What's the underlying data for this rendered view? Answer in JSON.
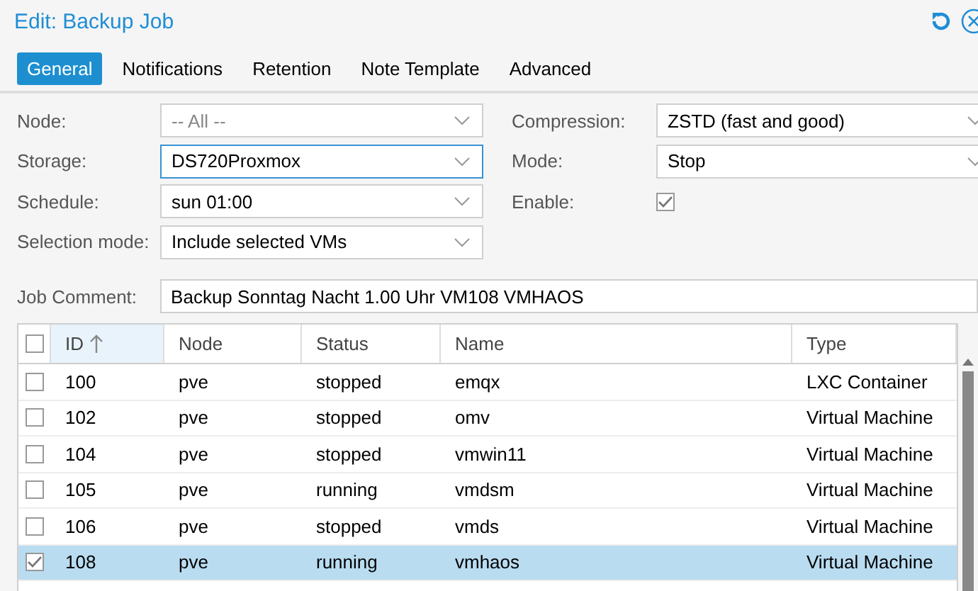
{
  "window": {
    "title": "Edit: Backup Job"
  },
  "tabs": [
    {
      "label": "General",
      "selected": true
    },
    {
      "label": "Notifications",
      "selected": false
    },
    {
      "label": "Retention",
      "selected": false
    },
    {
      "label": "Note Template",
      "selected": false
    },
    {
      "label": "Advanced",
      "selected": false
    }
  ],
  "left_fields": [
    {
      "label": "Node:",
      "kind": "select",
      "placeholder": "-- All --",
      "focused": false
    },
    {
      "label": "Storage:",
      "kind": "select",
      "value": "DS720Proxmox",
      "focused": true
    },
    {
      "label": "Schedule:",
      "kind": "select",
      "value": "sun 01:00",
      "focused": false
    },
    {
      "label": "Selection mode:",
      "kind": "select",
      "value": "Include selected VMs",
      "focused": false
    }
  ],
  "right_fields": [
    {
      "label": "Compression:",
      "kind": "select",
      "value": "ZSTD (fast and good)"
    },
    {
      "label": "Mode:",
      "kind": "select",
      "value": "Stop"
    },
    {
      "label": "Enable:",
      "kind": "checkbox",
      "checked": true
    }
  ],
  "job_comment": {
    "label": "Job Comment:",
    "value": "Backup Sonntag Nacht 1.00 Uhr VM108 VMHAOS"
  },
  "table": {
    "all_checked": false,
    "columns": [
      {
        "label": "ID",
        "sorted": true
      },
      {
        "label": "Node",
        "sorted": false
      },
      {
        "label": "Status",
        "sorted": false
      },
      {
        "label": "Name",
        "sorted": false
      },
      {
        "label": "Type",
        "sorted": false
      }
    ],
    "rows": [
      {
        "checked": false,
        "selected": false,
        "cells": [
          "100",
          "pve",
          "stopped",
          "emqx",
          "LXC Container"
        ]
      },
      {
        "checked": false,
        "selected": false,
        "cells": [
          "102",
          "pve",
          "stopped",
          "omv",
          "Virtual Machine"
        ]
      },
      {
        "checked": false,
        "selected": false,
        "cells": [
          "104",
          "pve",
          "stopped",
          "vmwin11",
          "Virtual Machine"
        ]
      },
      {
        "checked": false,
        "selected": false,
        "cells": [
          "105",
          "pve",
          "running",
          "vmdsm",
          "Virtual Machine"
        ]
      },
      {
        "checked": false,
        "selected": false,
        "cells": [
          "106",
          "pve",
          "stopped",
          "vmds",
          "Virtual Machine"
        ]
      },
      {
        "checked": true,
        "selected": true,
        "cells": [
          "108",
          "pve",
          "running",
          "vmhaos",
          "Virtual Machine"
        ]
      }
    ]
  }
}
